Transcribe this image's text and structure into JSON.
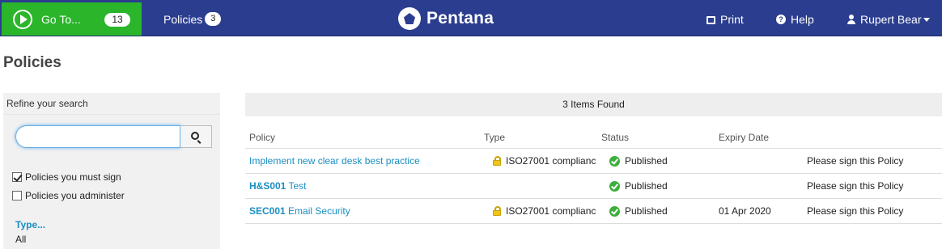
{
  "topbar": {
    "goto_label": "Go To...",
    "goto_count": "13",
    "policies_label": "Policies",
    "policies_count": "3",
    "brand": "Pentana",
    "print_label": "Print",
    "help_label": "Help",
    "user_name": "Rupert Bear",
    "colors": {
      "bar": "#2b3d8f",
      "goto": "#2ab52a",
      "link": "#1a8ec2"
    }
  },
  "page": {
    "title": "Policies"
  },
  "sidebar": {
    "heading": "Refine your search",
    "search_value": "",
    "filters": [
      {
        "label": "Policies you must sign",
        "checked": true
      },
      {
        "label": "Policies you administer",
        "checked": false
      }
    ],
    "facet_title": "Type...",
    "facet_value": "All"
  },
  "results": {
    "summary": "3 Items Found",
    "columns": [
      "Policy",
      "Type",
      "Status",
      "Expiry Date"
    ],
    "rows": [
      {
        "code": "",
        "name": "Implement new clear desk best practice",
        "type": "ISO27001 complianc",
        "type_icon": "lock-icon",
        "status": "Published",
        "expiry": "",
        "action": "Please sign this Policy"
      },
      {
        "code": "H&S001",
        "name": "Test",
        "type": "",
        "type_icon": "",
        "status": "Published",
        "expiry": "",
        "action": "Please sign this Policy"
      },
      {
        "code": "SEC001",
        "name": "Email Security",
        "type": "ISO27001 complianc",
        "type_icon": "lock-icon",
        "status": "Published",
        "expiry": "01 Apr 2020",
        "action": "Please sign this Policy"
      }
    ]
  }
}
